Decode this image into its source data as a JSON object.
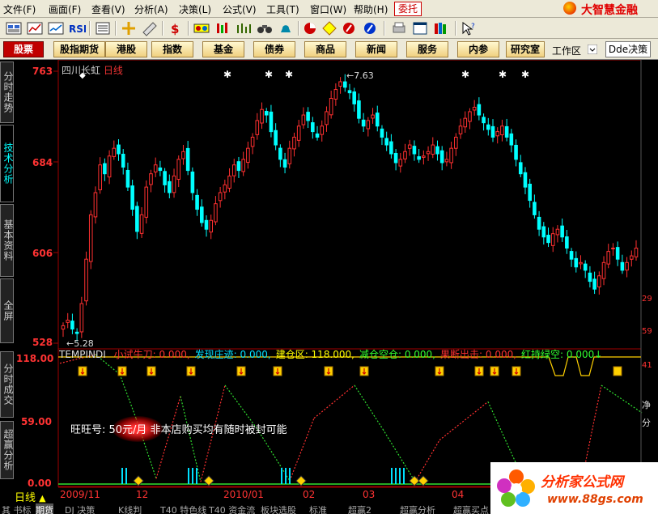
{
  "menu": [
    {
      "label": "文件(F)"
    },
    {
      "label": "画面(F)"
    },
    {
      "label": "查看(V)"
    },
    {
      "label": "分析(A)"
    },
    {
      "label": "决策(L)"
    },
    {
      "label": "公式(V)"
    },
    {
      "label": "工具(T)"
    },
    {
      "label": "窗口(W)"
    },
    {
      "label": "帮助(H)"
    }
  ],
  "entrust_label": "委托",
  "brand": "大智慧金融",
  "nav": {
    "stocks": "股票",
    "items": [
      "股指期货",
      "港股",
      "指数",
      "基金",
      "债券",
      "商品",
      "新闻",
      "服务",
      "内参",
      "研究室"
    ],
    "workspace": "工作区",
    "dde": "Dde决策"
  },
  "sidebar": [
    "分时走势",
    "技术分析",
    "基本资料",
    "全屏",
    "分时成交",
    "超赢分析"
  ],
  "stock": {
    "name": "四川长虹",
    "period": "日线"
  },
  "price_axis": [
    "763",
    "684",
    "606",
    "528"
  ],
  "high_marker": "7.63",
  "low_marker": "5.28",
  "indicator_axis": [
    "118.00",
    "59.00",
    "0.00"
  ],
  "indicator": {
    "name": "TEMPINDI",
    "parts": [
      {
        "label": "小试牛刀: 0.000,",
        "color": "#ff3030"
      },
      {
        "label": "发现庄迹: 0.000,",
        "color": "#00e0ff"
      },
      {
        "label": "建仓区: 118.000,",
        "color": "#ffff00"
      },
      {
        "label": "减仓空仓: 0.000,",
        "color": "#30ff30"
      },
      {
        "label": "果断出击: 0.000,",
        "color": "#ff3030"
      },
      {
        "label": "红持绿空: 0.000↓",
        "color": "#30ff30"
      }
    ]
  },
  "ad_text": "旺旺号:              50元/月  非本店购买均有随时被封可能",
  "dates": [
    "2009/11",
    "12",
    "2010/01",
    "02",
    "03",
    "04"
  ],
  "period_label": "日线",
  "bottom_tabs": [
    "其 书标",
    "期货",
    "DJ 决策",
    "K线判",
    "T40 特色线",
    "T40 资金流",
    "板块选股",
    "标准",
    "超赢2",
    "超赢分析",
    "超赢买点"
  ],
  "right_labels": [
    "29",
    "59",
    "41",
    "净",
    "分"
  ],
  "watermark": {
    "title": "分析家公式网",
    "url": "www.88gs.com"
  },
  "chart_data": {
    "type": "candlestick",
    "title": "四川长虹 日线",
    "ylim": [
      5.28,
      7.63
    ],
    "x_range": [
      "2009/11",
      "2010/04"
    ],
    "closes": [
      5.35,
      5.4,
      5.32,
      5.28,
      5.55,
      5.95,
      6.35,
      6.55,
      6.8,
      6.72,
      6.88,
      6.95,
      6.9,
      6.78,
      6.6,
      6.4,
      6.2,
      6.35,
      6.6,
      6.72,
      6.8,
      6.75,
      6.62,
      6.55,
      6.7,
      6.85,
      6.92,
      6.75,
      6.55,
      6.4,
      6.28,
      6.22,
      6.3,
      6.45,
      6.55,
      6.62,
      6.7,
      6.8,
      6.75,
      6.85,
      6.95,
      7.05,
      7.2,
      7.3,
      7.25,
      7.1,
      6.98,
      6.85,
      6.78,
      6.95,
      7.05,
      7.15,
      7.25,
      7.2,
      7.1,
      7.05,
      7.15,
      7.28,
      7.4,
      7.48,
      7.55,
      7.5,
      7.45,
      7.35,
      7.22,
      7.15,
      7.2,
      7.25,
      7.15,
      7.05,
      6.98,
      6.9,
      6.82,
      6.85,
      6.92,
      6.98,
      6.9,
      6.85,
      6.88,
      6.92,
      6.98,
      6.9,
      6.82,
      6.85,
      6.95,
      7.05,
      7.15,
      7.22,
      7.28,
      7.32,
      7.25,
      7.18,
      7.12,
      7.05,
      7.1,
      7.15,
      7.05,
      6.98,
      6.85,
      6.72,
      6.6,
      6.48,
      6.35,
      6.22,
      6.15,
      6.1,
      6.18,
      6.22,
      6.15,
      6.05,
      5.95,
      5.88,
      5.92,
      5.85,
      5.75,
      5.68,
      5.8,
      5.92,
      6.02,
      6.05,
      5.95,
      5.85,
      5.92,
      5.98,
      6.05
    ]
  }
}
